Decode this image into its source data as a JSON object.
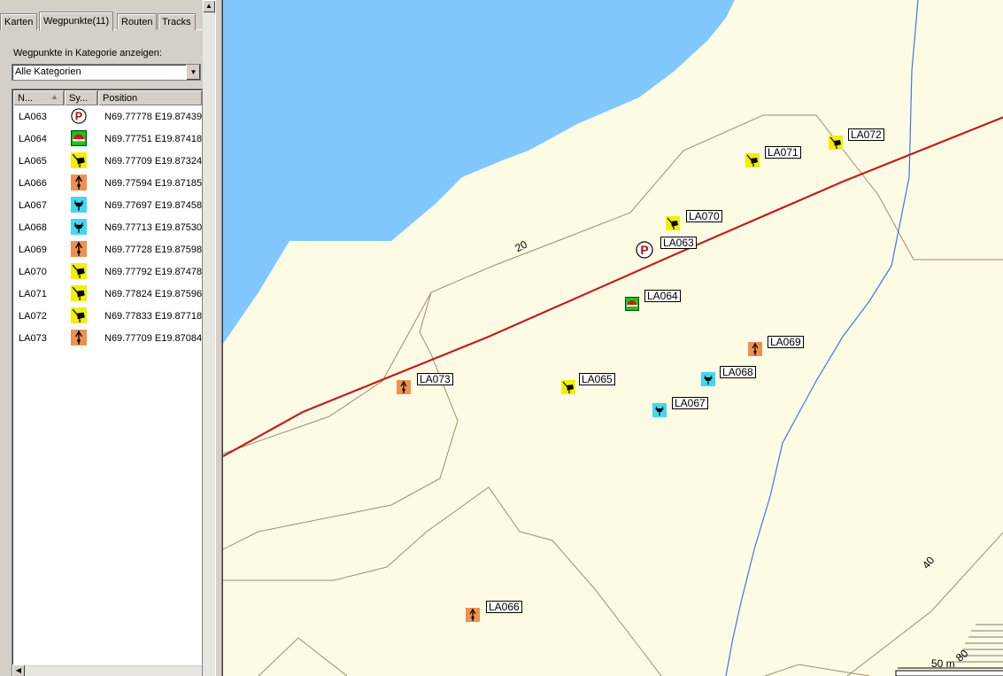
{
  "tabs": [
    {
      "label": "Karten",
      "active": false
    },
    {
      "label": "Wegpunkte(11)",
      "active": true
    },
    {
      "label": "Routen",
      "active": false
    },
    {
      "label": "Tracks",
      "active": false
    }
  ],
  "filter": {
    "label": "Wegpunkte in Kategorie anzeigen:",
    "selected": "Alle Kategorien"
  },
  "columns": [
    "N...",
    "Sy...",
    "Position"
  ],
  "waypoints": [
    {
      "name": "LA063",
      "symbol": "parking-icon",
      "position": "N69.77778 E19.87439"
    },
    {
      "name": "LA064",
      "symbol": "restaurant-icon",
      "position": "N69.77751 E19.87418"
    },
    {
      "name": "LA065",
      "symbol": "hunting-stand-icon",
      "position": "N69.77709 E19.87324"
    },
    {
      "name": "LA066",
      "symbol": "tree-marker-icon",
      "position": "N69.77594 E19.87185"
    },
    {
      "name": "LA067",
      "symbol": "blind-icon",
      "position": "N69.77697 E19.87458"
    },
    {
      "name": "LA068",
      "symbol": "blind-icon",
      "position": "N69.77713 E19.87530"
    },
    {
      "name": "LA069",
      "symbol": "tree-marker-icon",
      "position": "N69.77728 E19.87598"
    },
    {
      "name": "LA070",
      "symbol": "hunting-stand-icon",
      "position": "N69.77792 E19.87478"
    },
    {
      "name": "LA071",
      "symbol": "hunting-stand-icon",
      "position": "N69.77824 E19.87596"
    },
    {
      "name": "LA072",
      "symbol": "hunting-stand-icon",
      "position": "N69.77833 E19.87718"
    },
    {
      "name": "LA073",
      "symbol": "tree-marker-icon",
      "position": "N69.77709 E19.87084"
    }
  ],
  "map": {
    "contour_labels": [
      "20",
      "40",
      "80"
    ],
    "scale": "50 m",
    "colors": {
      "water": "#80c8ff",
      "land": "#fefbe4",
      "road": "#c0201c",
      "stream": "#3c78e0",
      "contour": "#a08c6e"
    }
  }
}
